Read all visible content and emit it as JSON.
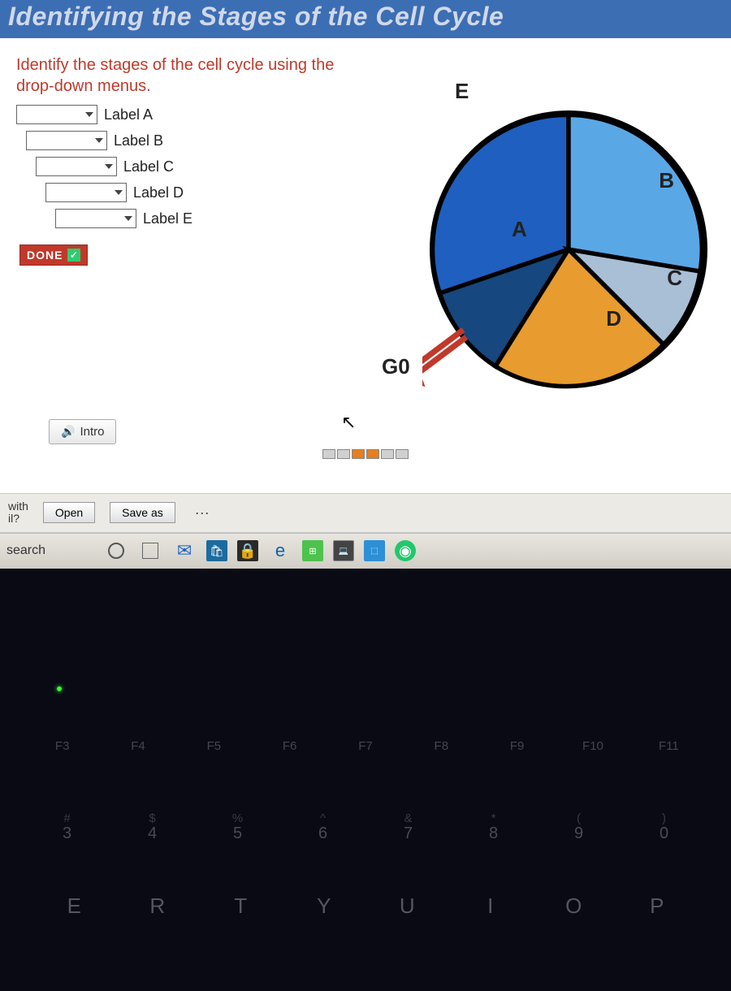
{
  "header": {
    "title": "Identifying the Stages of the Cell Cycle"
  },
  "activity": {
    "instructions": "Identify the stages of the cell cycle using the drop-down menus.",
    "labels": [
      {
        "name": "Label A"
      },
      {
        "name": "Label B"
      },
      {
        "name": "Label C"
      },
      {
        "name": "Label D"
      },
      {
        "name": "Label E"
      }
    ],
    "done": "DONE",
    "intro": "Intro"
  },
  "diagram": {
    "E": "E",
    "A": "A",
    "B": "B",
    "C": "C",
    "D": "D",
    "G0": "G0"
  },
  "chart_data": {
    "type": "pie",
    "title": "Cell Cycle Stages",
    "series": [
      {
        "name": "A",
        "color": "#1f5fbf",
        "approx_fraction": 0.33
      },
      {
        "name": "B",
        "color": "#5aa7e6",
        "approx_fraction": 0.22
      },
      {
        "name": "C",
        "color": "#a8bfd6",
        "approx_fraction": 0.11
      },
      {
        "name": "D",
        "color": "#e89b2e",
        "approx_fraction": 0.22
      },
      {
        "name": "E",
        "color": "#16477f",
        "approx_fraction": 0.12
      }
    ],
    "annotations": [
      "G0 exit arrow from segment D region"
    ]
  },
  "download_bar": {
    "prompt_line1": "with",
    "prompt_line2": "il?",
    "open": "Open",
    "save_as": "Save as",
    "more": "···"
  },
  "taskbar": {
    "search": "search"
  },
  "keyboard": {
    "fn": [
      "F3",
      "F4",
      "F5",
      "F6",
      "F7",
      "F8",
      "F9",
      "F10",
      "F11"
    ],
    "num": [
      {
        "sym": "#",
        "n": "3"
      },
      {
        "sym": "$",
        "n": "4"
      },
      {
        "sym": "%",
        "n": "5"
      },
      {
        "sym": "^",
        "n": "6"
      },
      {
        "sym": "&",
        "n": "7"
      },
      {
        "sym": "*",
        "n": "8"
      },
      {
        "sym": "(",
        "n": "9"
      },
      {
        "sym": ")",
        "n": "0"
      }
    ],
    "letters": [
      "E",
      "R",
      "T",
      "Y",
      "U",
      "I",
      "O",
      "P"
    ]
  }
}
